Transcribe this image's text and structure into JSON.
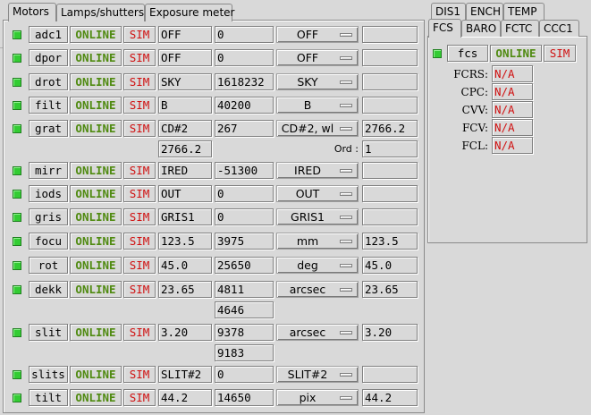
{
  "left_tabs": [
    "Motors",
    "Lamps/shutters",
    "Exposure meter"
  ],
  "right_tabs_row1": [
    "DIS1",
    "ENCH",
    "TEMP"
  ],
  "right_tabs_row2": [
    "FCS",
    "BARO",
    "FCTC",
    "CCC1"
  ],
  "status_online": "ONLINE",
  "status_sim": "SIM",
  "motors": [
    {
      "name": "adc1",
      "value": "OFF",
      "position": "0",
      "menu": "OFF",
      "entry": ""
    },
    {
      "name": "dpor",
      "value": "OFF",
      "position": "0",
      "menu": "OFF",
      "entry": ""
    },
    {
      "name": "drot",
      "value": "SKY",
      "position": "1618232",
      "menu": "SKY",
      "entry": ""
    },
    {
      "name": "filt",
      "value": "B",
      "position": "40200",
      "menu": "B",
      "entry": ""
    },
    {
      "name": "grat",
      "value": "CD#2",
      "position": "267",
      "menu": "CD#2, wl",
      "entry": "2766.2",
      "position2": "2766.2",
      "ord_label": "Ord :",
      "ord_value": "1"
    },
    {
      "name": "mirr",
      "value": "IRED",
      "position": "-51300",
      "menu": "IRED",
      "entry": ""
    },
    {
      "name": "iods",
      "value": "OUT",
      "position": "0",
      "menu": "OUT",
      "entry": ""
    },
    {
      "name": "gris",
      "value": "GRIS1",
      "position": "0",
      "menu": "GRIS1",
      "entry": ""
    },
    {
      "name": "focu",
      "value": "123.5",
      "position": "3975",
      "menu": "mm",
      "entry": "123.5"
    },
    {
      "name": "rot",
      "value": "45.0",
      "position": "25650",
      "menu": "deg",
      "entry": "45.0"
    },
    {
      "name": "dekk",
      "value": "23.65",
      "position": "4811",
      "menu": "arcsec",
      "entry": "23.65",
      "position2": "4646"
    },
    {
      "name": "slit",
      "value": "3.20",
      "position": "9378",
      "menu": "arcsec",
      "entry": "3.20",
      "position2": "9183"
    },
    {
      "name": "slits",
      "value": "SLIT#2",
      "position": "0",
      "menu": "SLIT#2",
      "entry": ""
    },
    {
      "name": "tilt",
      "value": "44.2",
      "position": "14650",
      "menu": "pix",
      "entry": "44.2"
    }
  ],
  "fcs": {
    "name": "fcs",
    "status_online": "ONLINE",
    "status_sim": "SIM",
    "readouts": [
      {
        "label": "FCRS:",
        "value": "N/A"
      },
      {
        "label": "CPC:",
        "value": "N/A"
      },
      {
        "label": "CVV:",
        "value": "N/A"
      },
      {
        "label": "FCV:",
        "value": "N/A"
      },
      {
        "label": "FCL:",
        "value": "N/A"
      }
    ]
  },
  "colors": {
    "led_green": "#33cc33",
    "online_green": "#4f8a10",
    "sim_red": "#d01010",
    "background": "#d9d9d9"
  }
}
